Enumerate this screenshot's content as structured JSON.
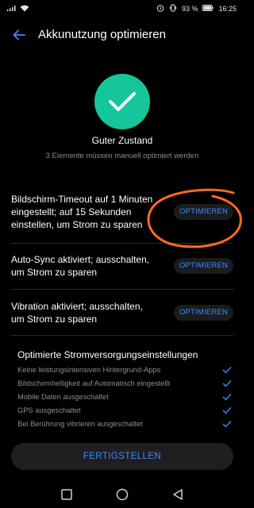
{
  "statusbar": {
    "battery": "93 %",
    "time": "16:25"
  },
  "header": {
    "title": "Akkunutzung optimieren"
  },
  "status": {
    "title": "Guter Zustand",
    "subtitle": "3 Elemente müssen manuell optimiert werden"
  },
  "items": [
    {
      "lines": [
        "Bildschirm-Timeout auf 1 Minuten",
        "eingestellt; auf 15 Sekunden",
        "einstellen, um Strom zu sparen"
      ],
      "button": "OPTIMIEREN"
    },
    {
      "lines": [
        "Auto-Sync aktiviert; ausschalten,",
        "um Strom zu sparen"
      ],
      "button": "OPTIMIEREN"
    },
    {
      "lines": [
        "Vibration aktiviert; ausschalten,",
        "um Strom zu sparen"
      ],
      "button": "OPTIMIEREN"
    }
  ],
  "optimized": {
    "title": "Optimierte Stromversorgungseinstellungen",
    "rows": [
      "Keine leistungsintensiven Hintergrund-Apps",
      "Bildschirmhelligkeit auf Automatisch eingestellt",
      "Mobile Daten ausgeschaltet",
      "GPS ausgeschaltet",
      "Bei Berührung vibrieren ausgeschaltet"
    ]
  },
  "finish_label": "FERTIGSTELLEN",
  "colors": {
    "accent": "#3b8bff",
    "success": "#15c59b",
    "annotation": "#ff6a1f"
  },
  "icons": [
    "wifi-icon",
    "alarm-icon",
    "vibrate-icon",
    "battery-icon",
    "back-arrow-icon",
    "checkmark-icon",
    "check-icon",
    "back-nav-icon",
    "home-nav-icon",
    "recents-nav-icon"
  ]
}
